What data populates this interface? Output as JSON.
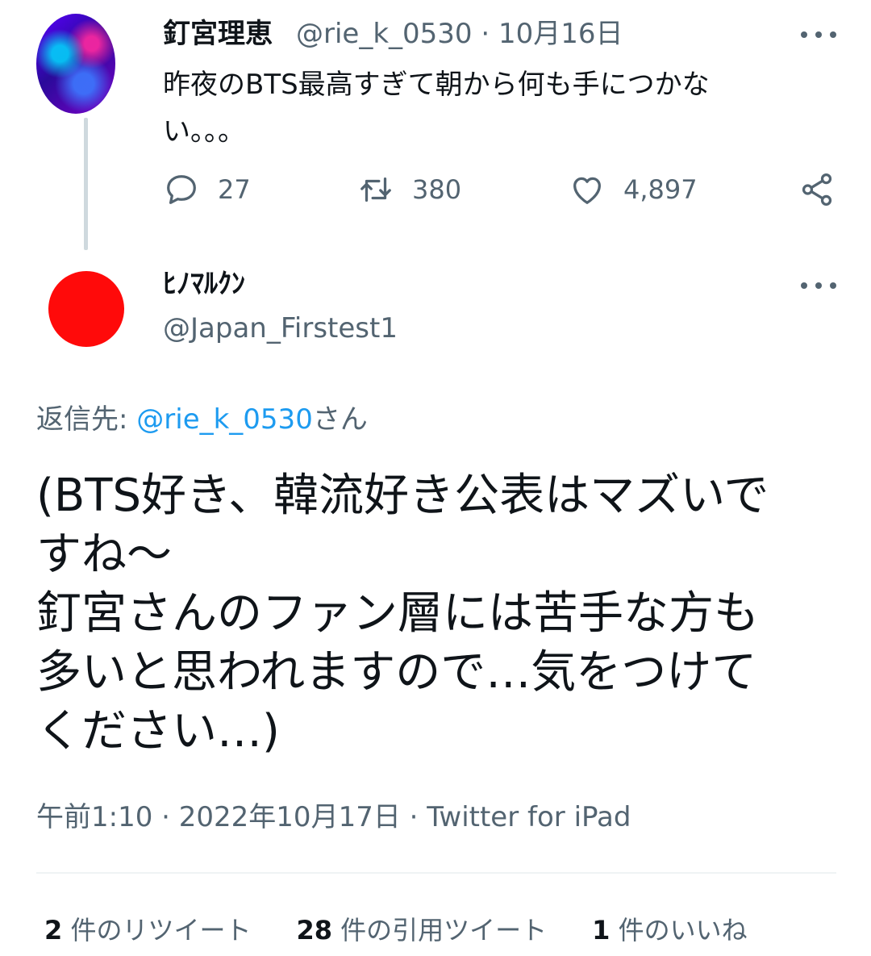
{
  "parent_tweet": {
    "author_name": "釘宮理恵",
    "meta": "@rie_k_0530 · 10月16日",
    "text_line1": "昨夜のBTS最高すぎて朝から何も手につかな",
    "text_line2": "い。。。",
    "reply_count": "27",
    "retweet_count": "380",
    "like_count": "4,897"
  },
  "reply_tweet": {
    "author_name": "ﾋﾉﾏﾙｸﾝ",
    "handle": "@Japan_Firstest1",
    "reply_to_label": "返信先: ",
    "reply_to_handle": "@rie_k_0530",
    "reply_to_suffix": "さん",
    "body_lines": [
      "(BTS好き、韓流好き公表はマズいで",
      "すね〜",
      "釘宮さんのファン層には苦手な方も",
      "多いと思われますので…気をつけて",
      "ください…)"
    ],
    "timestamp": "午前1:10 · 2022年10月17日 · Twitter for iPad"
  },
  "stats": {
    "retweets_num": "2",
    "retweets_label": "件のリツイート",
    "quotes_num": "28",
    "quotes_label": "件の引用ツイート",
    "likes_num": "1",
    "likes_label": "件のいいね"
  },
  "colors": {
    "text": "#0f1419",
    "secondary": "#536471",
    "link": "#1d9bf0",
    "reply_avatar": "#ff0a0a"
  },
  "icons": {
    "reply": "reply-icon",
    "retweet": "retweet-icon",
    "like": "heart-icon",
    "share": "share-icon",
    "more": "more-icon"
  }
}
